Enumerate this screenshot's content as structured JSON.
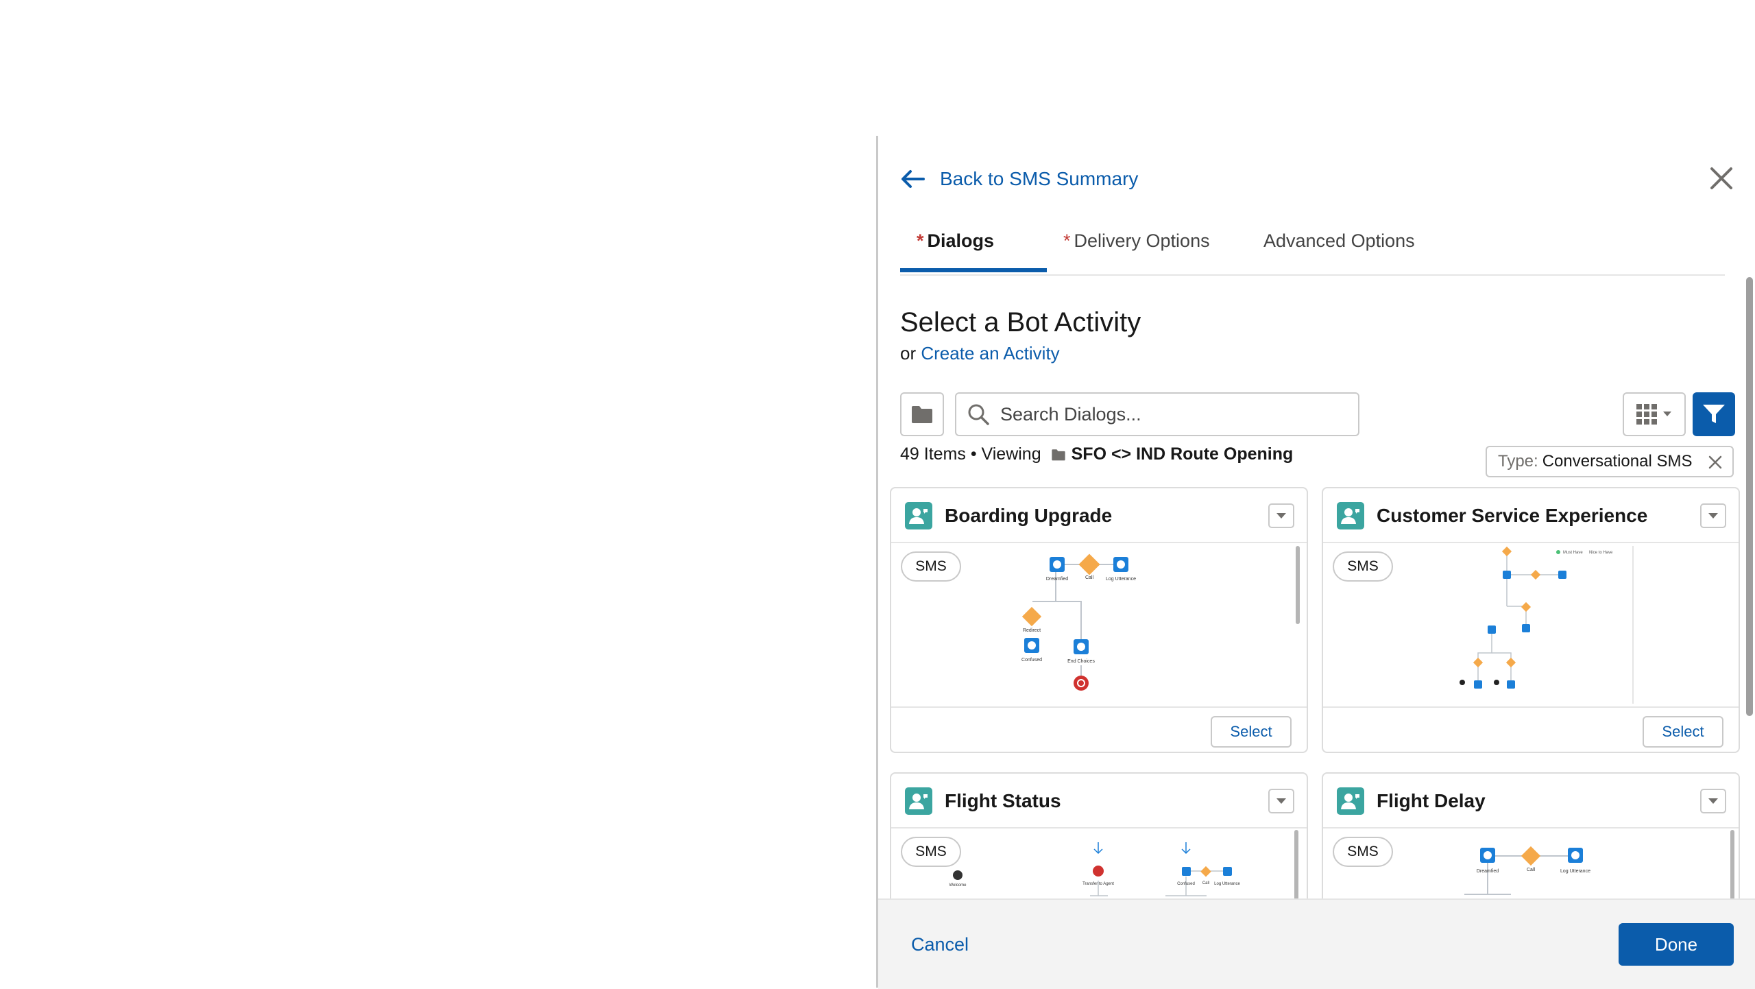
{
  "header": {
    "back_label": "Back to SMS Summary"
  },
  "tabs": [
    {
      "label": "Dialogs",
      "required": "*"
    },
    {
      "label": "Delivery Options",
      "required": "*"
    },
    {
      "label": "Advanced Options",
      "required": ""
    }
  ],
  "main": {
    "title": "Select a Bot Activity",
    "or_text": "or",
    "create_link": "Create an Activity"
  },
  "search": {
    "placeholder": "Search Dialogs..."
  },
  "results": {
    "count": "49 Items • Viewing",
    "folder": "SFO <> IND Route Opening"
  },
  "filter_pill": {
    "key": "Type:",
    "value": "Conversational SMS"
  },
  "cards": [
    {
      "title": "Boarding Upgrade",
      "badge": "SMS",
      "select_label": "Select"
    },
    {
      "title": "Customer Service Experience",
      "badge": "SMS",
      "select_label": "Select"
    },
    {
      "title": "Flight Status",
      "badge": "SMS"
    },
    {
      "title": "Flight Delay",
      "badge": "SMS"
    }
  ],
  "diagram_labels": {
    "boarding": [
      "Dreamfied",
      "Call",
      "Log Utterance",
      "Redirect",
      "Confused",
      "End Choices"
    ],
    "customer": [
      "Must Have",
      "Nice to Have"
    ],
    "flight_status": [
      "Welcome",
      "Transfer to Agent",
      "Confused",
      "Call",
      "Log Utterance"
    ],
    "flight_delay": [
      "Dreamfied",
      "Call",
      "Log Utterance"
    ]
  },
  "footer": {
    "cancel_label": "Cancel",
    "done_label": "Done"
  },
  "colors": {
    "brand": "#0b5cab",
    "card_icon": "#3ba5a0",
    "node_blue": "#1b7fd8",
    "node_orange": "#f5a94a",
    "node_red": "#d0322f"
  }
}
